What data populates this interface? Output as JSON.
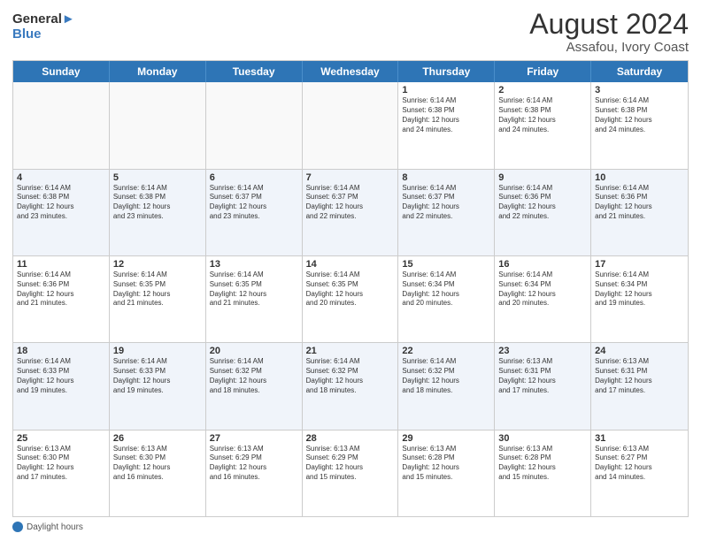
{
  "header": {
    "logo_general": "General",
    "logo_blue": "Blue",
    "month_year": "August 2024",
    "location": "Assafou, Ivory Coast"
  },
  "days_of_week": [
    "Sunday",
    "Monday",
    "Tuesday",
    "Wednesday",
    "Thursday",
    "Friday",
    "Saturday"
  ],
  "footer": {
    "label": "Daylight hours"
  },
  "weeks": [
    [
      {
        "day": "",
        "empty": true
      },
      {
        "day": "",
        "empty": true
      },
      {
        "day": "",
        "empty": true
      },
      {
        "day": "",
        "empty": true
      },
      {
        "day": "1",
        "info": "Sunrise: 6:14 AM\nSunset: 6:38 PM\nDaylight: 12 hours\nand 24 minutes."
      },
      {
        "day": "2",
        "info": "Sunrise: 6:14 AM\nSunset: 6:38 PM\nDaylight: 12 hours\nand 24 minutes."
      },
      {
        "day": "3",
        "info": "Sunrise: 6:14 AM\nSunset: 6:38 PM\nDaylight: 12 hours\nand 24 minutes."
      }
    ],
    [
      {
        "day": "4",
        "info": "Sunrise: 6:14 AM\nSunset: 6:38 PM\nDaylight: 12 hours\nand 23 minutes."
      },
      {
        "day": "5",
        "info": "Sunrise: 6:14 AM\nSunset: 6:38 PM\nDaylight: 12 hours\nand 23 minutes."
      },
      {
        "day": "6",
        "info": "Sunrise: 6:14 AM\nSunset: 6:37 PM\nDaylight: 12 hours\nand 23 minutes."
      },
      {
        "day": "7",
        "info": "Sunrise: 6:14 AM\nSunset: 6:37 PM\nDaylight: 12 hours\nand 22 minutes."
      },
      {
        "day": "8",
        "info": "Sunrise: 6:14 AM\nSunset: 6:37 PM\nDaylight: 12 hours\nand 22 minutes."
      },
      {
        "day": "9",
        "info": "Sunrise: 6:14 AM\nSunset: 6:36 PM\nDaylight: 12 hours\nand 22 minutes."
      },
      {
        "day": "10",
        "info": "Sunrise: 6:14 AM\nSunset: 6:36 PM\nDaylight: 12 hours\nand 21 minutes."
      }
    ],
    [
      {
        "day": "11",
        "info": "Sunrise: 6:14 AM\nSunset: 6:36 PM\nDaylight: 12 hours\nand 21 minutes."
      },
      {
        "day": "12",
        "info": "Sunrise: 6:14 AM\nSunset: 6:35 PM\nDaylight: 12 hours\nand 21 minutes."
      },
      {
        "day": "13",
        "info": "Sunrise: 6:14 AM\nSunset: 6:35 PM\nDaylight: 12 hours\nand 21 minutes."
      },
      {
        "day": "14",
        "info": "Sunrise: 6:14 AM\nSunset: 6:35 PM\nDaylight: 12 hours\nand 20 minutes."
      },
      {
        "day": "15",
        "info": "Sunrise: 6:14 AM\nSunset: 6:34 PM\nDaylight: 12 hours\nand 20 minutes."
      },
      {
        "day": "16",
        "info": "Sunrise: 6:14 AM\nSunset: 6:34 PM\nDaylight: 12 hours\nand 20 minutes."
      },
      {
        "day": "17",
        "info": "Sunrise: 6:14 AM\nSunset: 6:34 PM\nDaylight: 12 hours\nand 19 minutes."
      }
    ],
    [
      {
        "day": "18",
        "info": "Sunrise: 6:14 AM\nSunset: 6:33 PM\nDaylight: 12 hours\nand 19 minutes."
      },
      {
        "day": "19",
        "info": "Sunrise: 6:14 AM\nSunset: 6:33 PM\nDaylight: 12 hours\nand 19 minutes."
      },
      {
        "day": "20",
        "info": "Sunrise: 6:14 AM\nSunset: 6:32 PM\nDaylight: 12 hours\nand 18 minutes."
      },
      {
        "day": "21",
        "info": "Sunrise: 6:14 AM\nSunset: 6:32 PM\nDaylight: 12 hours\nand 18 minutes."
      },
      {
        "day": "22",
        "info": "Sunrise: 6:14 AM\nSunset: 6:32 PM\nDaylight: 12 hours\nand 18 minutes."
      },
      {
        "day": "23",
        "info": "Sunrise: 6:13 AM\nSunset: 6:31 PM\nDaylight: 12 hours\nand 17 minutes."
      },
      {
        "day": "24",
        "info": "Sunrise: 6:13 AM\nSunset: 6:31 PM\nDaylight: 12 hours\nand 17 minutes."
      }
    ],
    [
      {
        "day": "25",
        "info": "Sunrise: 6:13 AM\nSunset: 6:30 PM\nDaylight: 12 hours\nand 17 minutes."
      },
      {
        "day": "26",
        "info": "Sunrise: 6:13 AM\nSunset: 6:30 PM\nDaylight: 12 hours\nand 16 minutes."
      },
      {
        "day": "27",
        "info": "Sunrise: 6:13 AM\nSunset: 6:29 PM\nDaylight: 12 hours\nand 16 minutes."
      },
      {
        "day": "28",
        "info": "Sunrise: 6:13 AM\nSunset: 6:29 PM\nDaylight: 12 hours\nand 15 minutes."
      },
      {
        "day": "29",
        "info": "Sunrise: 6:13 AM\nSunset: 6:28 PM\nDaylight: 12 hours\nand 15 minutes."
      },
      {
        "day": "30",
        "info": "Sunrise: 6:13 AM\nSunset: 6:28 PM\nDaylight: 12 hours\nand 15 minutes."
      },
      {
        "day": "31",
        "info": "Sunrise: 6:13 AM\nSunset: 6:27 PM\nDaylight: 12 hours\nand 14 minutes."
      }
    ]
  ]
}
